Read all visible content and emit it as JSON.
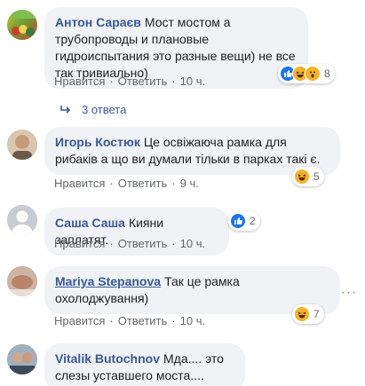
{
  "common": {
    "like": "Нравится",
    "reply": "Ответить",
    "dot": "·"
  },
  "comments": [
    {
      "author": "Антон Сараєв",
      "text": "Мост мостом а трубопроводы и плановые гидроиспытания это разные вещи) не все так тривиально)",
      "time": "10 ч.",
      "reactions": [
        "like-icon",
        "haha-icon",
        "wow-icon"
      ],
      "reaction_count": "8",
      "replies_label": "3 ответа"
    },
    {
      "author": "Игорь Костюк",
      "text": "Це освіжаюча рамка для рибаків а що ви думали тільки в парках такі є.",
      "time": "9 ч.",
      "reactions": [
        "haha-icon"
      ],
      "reaction_count": "5"
    },
    {
      "author": "Саша Саша",
      "text": "Кияни заплатят.",
      "time": "10 ч.",
      "reactions": [
        "like-icon"
      ],
      "reaction_count": "2"
    },
    {
      "author": "Mariya Stepanova",
      "text": "Так це рамка охолоджування)",
      "time": "10 ч.",
      "reactions": [
        "haha-icon"
      ],
      "reaction_count": "7"
    },
    {
      "author": "Vitalik Butochnov",
      "text": "Мда.... это слезы уставшего моста....",
      "time": ""
    }
  ],
  "menu_glyph": "···",
  "colors": {
    "link": "#385898",
    "bubble": "#f0f2f5",
    "meta": "#65676b",
    "like": "#1877f2",
    "haha": "#f7b125"
  }
}
